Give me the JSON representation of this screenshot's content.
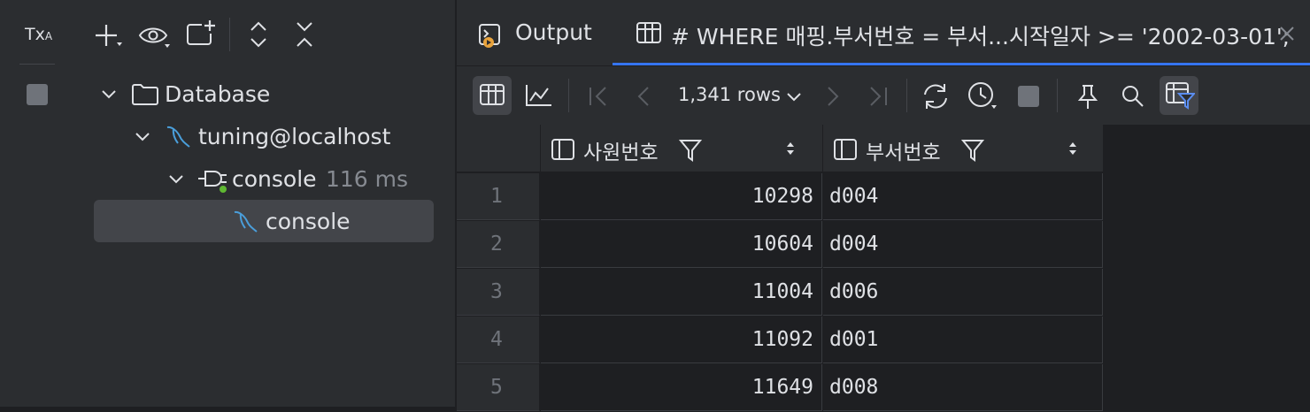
{
  "left": {
    "toolbar": {
      "tx_label": "Tx",
      "tx_sub": "A"
    },
    "tree": {
      "root_label": "Database",
      "datasource_label": "tuning@localhost",
      "console_label": "console",
      "console_time": "116 ms",
      "session_label": "console"
    }
  },
  "tabs": {
    "output_label": "Output",
    "query_label": "# WHERE 매핑.부서번호 = 부서...시작일자 >= '2002-03-01';"
  },
  "toolbar": {
    "rows_label": "1,341 rows"
  },
  "grid": {
    "columns": [
      "사원번호",
      "부서번호"
    ],
    "rows": [
      {
        "num": "1",
        "emp": "10298",
        "dept": "d004"
      },
      {
        "num": "2",
        "emp": "10604",
        "dept": "d004"
      },
      {
        "num": "3",
        "emp": "11004",
        "dept": "d006"
      },
      {
        "num": "4",
        "emp": "11092",
        "dept": "d001"
      },
      {
        "num": "5",
        "emp": "11649",
        "dept": "d008"
      }
    ]
  },
  "colors": {
    "accent": "#3574f0",
    "mysql_icon": "#4a9eda",
    "status_green": "#5fb832",
    "output_icon": "#e8a33d"
  }
}
